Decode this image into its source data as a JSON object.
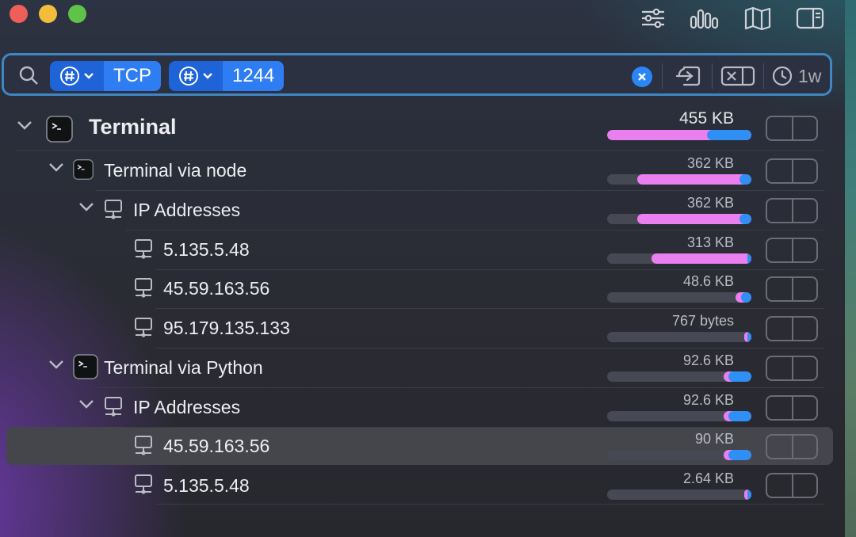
{
  "search": {
    "filters": [
      {
        "kind": "#",
        "value": "TCP"
      },
      {
        "kind": "#",
        "value": "1244"
      }
    ],
    "time_range": "1w"
  },
  "colors": {
    "incoming": "#ea7ff0",
    "outgoing": "#2f8ff5",
    "accent": "#2f7df3"
  },
  "tree": [
    {
      "label": "Terminal",
      "size": "455 KB",
      "incoming_fraction": 0.69,
      "outgoing_fraction": 0.31,
      "level": 0,
      "icon": "terminal-icon"
    },
    {
      "label": "Terminal via node",
      "size": "362 KB",
      "incoming_fraction": 0.71,
      "outgoing_fraction": 0.08,
      "level": 1,
      "icon": "terminal-icon"
    },
    {
      "label": "IP Addresses",
      "size": "362 KB",
      "incoming_fraction": 0.71,
      "outgoing_fraction": 0.08,
      "level": 2,
      "icon": "network-icon"
    },
    {
      "label": "5.135.5.48",
      "size": "313 KB",
      "incoming_fraction": 0.66,
      "outgoing_fraction": 0.03,
      "level": 3,
      "icon": "network-icon"
    },
    {
      "label": "45.59.163.56",
      "size": "48.6 KB",
      "incoming_fraction": 0.04,
      "outgoing_fraction": 0.07,
      "level": 3,
      "icon": "network-icon"
    },
    {
      "label": "95.179.135.133",
      "size": "767 bytes",
      "incoming_fraction": 0.02,
      "outgoing_fraction": 0.03,
      "level": 3,
      "icon": "network-icon"
    },
    {
      "label": "Terminal via Python",
      "size": "92.6 KB",
      "incoming_fraction": 0.03,
      "outgoing_fraction": 0.16,
      "level": 1,
      "icon": "terminal-icon"
    },
    {
      "label": "IP Addresses",
      "size": "92.6 KB",
      "incoming_fraction": 0.03,
      "outgoing_fraction": 0.16,
      "level": 2,
      "icon": "network-icon"
    },
    {
      "label": "45.59.163.56",
      "size": "90 KB",
      "incoming_fraction": 0.03,
      "outgoing_fraction": 0.16,
      "level": 3,
      "icon": "network-icon",
      "selected": true
    },
    {
      "label": "5.135.5.48",
      "size": "2.64 KB",
      "incoming_fraction": 0.02,
      "outgoing_fraction": 0.03,
      "level": 3,
      "icon": "network-icon"
    }
  ]
}
